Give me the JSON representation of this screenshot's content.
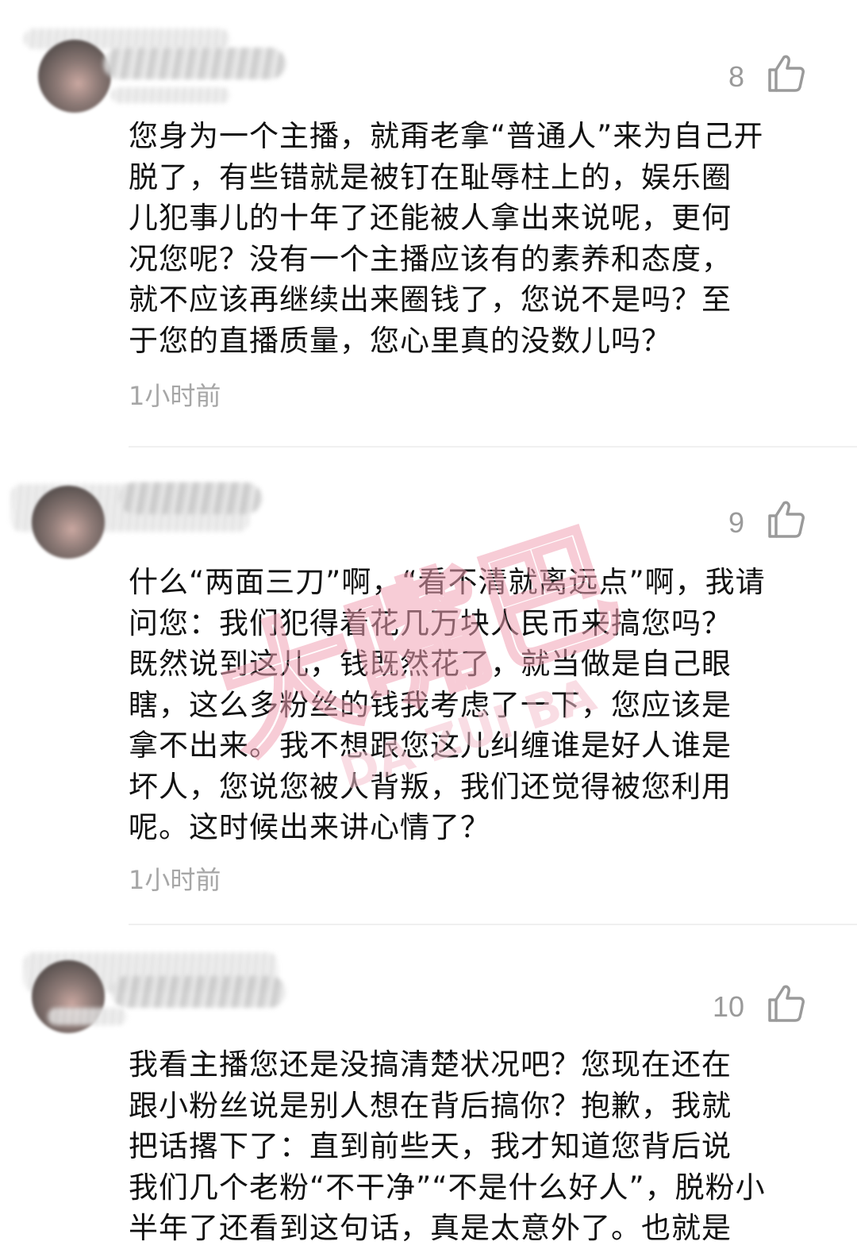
{
  "comments": [
    {
      "likes": "8",
      "lines": [
        "您身为一个主播，就甭老拿“普通人”来为自己开",
        "脱了，有些错就是被钉在耻辱柱上的，娱乐圈",
        "儿犯事儿的十年了还能被人拿出来说呢，更何",
        "况您呢？没有一个主播应该有的素养和态度，",
        "就不应该再继续出来圈钱了，您说不是吗？至",
        "于您的直播质量，您心里真的没数儿吗？"
      ],
      "time": "1小时前"
    },
    {
      "likes": "9",
      "lines": [
        "什么“两面三刀”啊，“看不清就离远点”啊，我请",
        "问您：我们犯得着花几万块人民币来搞您吗？",
        "既然说到这儿，钱既然花了，就当做是自己眼",
        "瞎，这么多粉丝的钱我考虑了一下，您应该是",
        "拿不出来。我不想跟您这儿纠缠谁是好人谁是",
        "坏人，您说您被人背叛，我们还觉得被您利用",
        "呢。这时候出来讲心情了？"
      ],
      "time": "1小时前"
    },
    {
      "likes": "10",
      "lines": [
        "我看主播您还是没搞清楚状况吧？您现在还在",
        "跟小粉丝说是别人想在背后搞你？抱歉，我就",
        "把话撂下了：直到前些天，我才知道您背后说",
        "我们几个老粉“不干净”“不是什么好人”，脱粉小",
        "半年了还看到这句话，真是太意外了。也就是"
      ]
    }
  ],
  "watermark": {
    "text": "大嘴巴",
    "sub": "DA ZUI BA"
  },
  "colors": {
    "text": "#111111",
    "meta": "#a6a6a6",
    "like_icon": "#9a9a9a",
    "watermark": "#f2a3b6"
  }
}
